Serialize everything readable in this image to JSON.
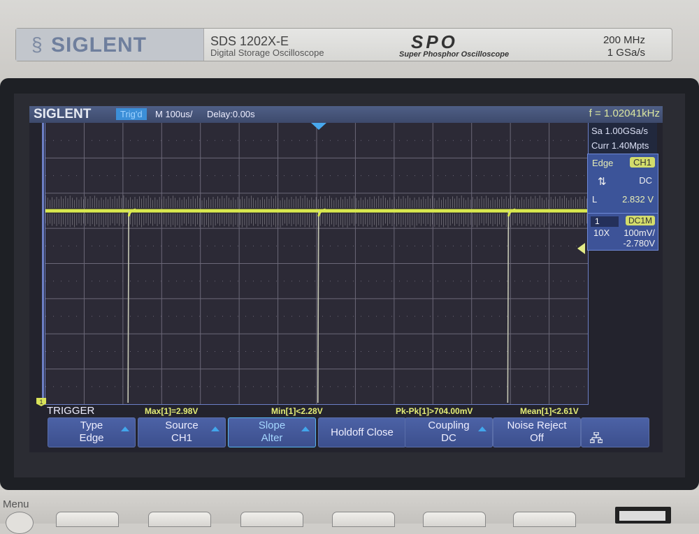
{
  "device": {
    "brand": "SIGLENT",
    "model": "SDS 1202X-E",
    "model_subtitle": "Digital Storage Oscilloscope",
    "spo_logo": "SPO",
    "spo_subtitle": "Super Phosphor Oscilloscope",
    "bandwidth": "200 MHz",
    "sample_rate_spec": "1 GSa/s",
    "menu_label": "Menu"
  },
  "screen": {
    "header": {
      "logo": "SIGLENT",
      "trigger_status": "Trig'd",
      "timebase": "M 100us/",
      "delay": "Delay:0.00s",
      "frequency": "f = 1.02041kHz"
    },
    "acquisition": {
      "sample_rate": "Sa 1.00GSa/s",
      "memory_depth": "Curr 1.40Mpts"
    },
    "trigger_info": {
      "type": "Edge",
      "source": "CH1",
      "slope_icon": "⇅",
      "coupling": "DC",
      "level_label": "L",
      "level_value": "2.832 V"
    },
    "channel1": {
      "number": "1",
      "coupling": "DC1M",
      "probe": "10X",
      "scale": "100mV/",
      "offset": "-2.780V",
      "color": "#d9e35a"
    },
    "measurements": [
      {
        "label": "Max[1]=2.98V"
      },
      {
        "label": "Min[1]<2.28V"
      },
      {
        "label": "Pk-Pk[1]>704.00mV"
      },
      {
        "label": "Mean[1]<2.61V"
      }
    ],
    "menu_title": "TRIGGER",
    "softkeys": [
      {
        "line1": "Type",
        "line2": "Edge",
        "arrow": true
      },
      {
        "line1": "Source",
        "line2": "CH1",
        "arrow": true
      },
      {
        "line1": "Slope",
        "line2": "Alter",
        "arrow": true,
        "active": true
      },
      {
        "line1": "Holdoff Close",
        "line2": "",
        "arrow": false
      },
      {
        "line1": "Coupling",
        "line2": "DC",
        "arrow": true
      },
      {
        "line1": "Noise Reject",
        "line2": "Off",
        "arrow": false
      },
      {
        "line1": "",
        "line2": "",
        "icon": "network-icon"
      }
    ],
    "waveform": {
      "channel": "CH1",
      "trace_color": "#d9e84e",
      "period_divisions": 4.9,
      "glitch_positions_div": [
        2.15,
        7.05,
        11.95
      ],
      "level_div_from_top": 2.5
    }
  }
}
